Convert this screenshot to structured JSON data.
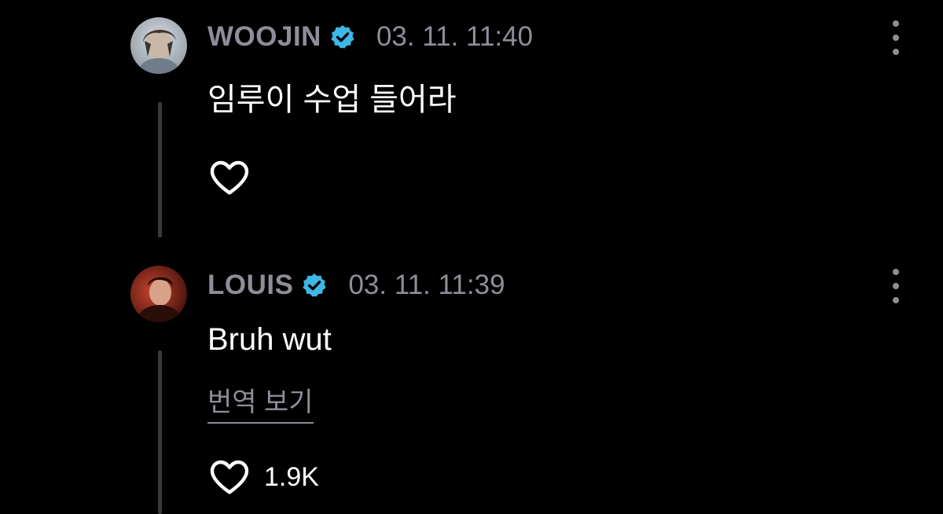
{
  "comments": [
    {
      "username": "WOOJIN",
      "timestamp": "03. 11. 11:40",
      "text": "임루이 수업 들어라",
      "avatar_icon": "user-avatar-woojin",
      "like_count": ""
    },
    {
      "username": "LOUIS",
      "timestamp": "03. 11. 11:39",
      "text": "Bruh wut",
      "translate_label": "번역 보기",
      "avatar_icon": "user-avatar-louis",
      "like_count": "1.9K"
    }
  ],
  "colors": {
    "background": "#000000",
    "muted_text": "#8e8e99",
    "primary_text": "#ffffff",
    "verified_badge": "#3eb7e6",
    "thread_line": "#3a3a3a"
  },
  "icons": {
    "verified": "verified-badge-icon",
    "more": "more-vertical-icon",
    "like": "heart-outline-icon"
  }
}
